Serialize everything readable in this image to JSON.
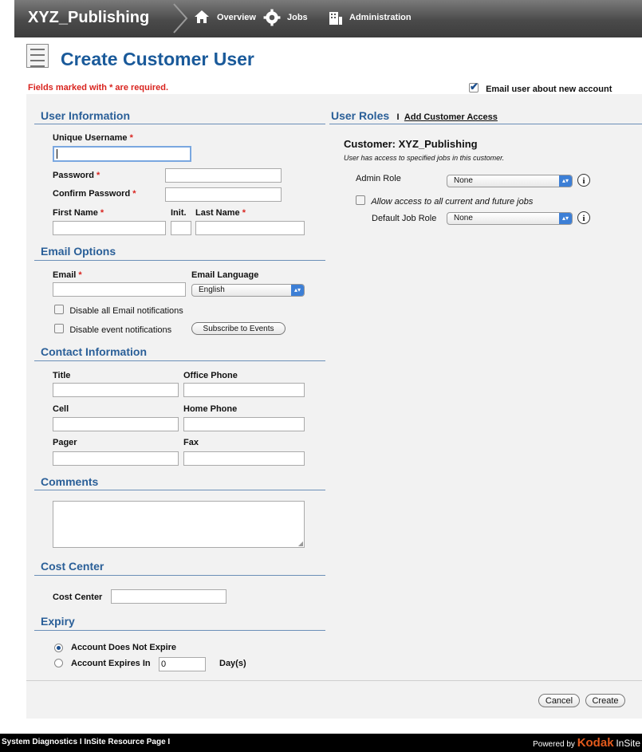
{
  "nav": {
    "brand": "XYZ_Publishing",
    "overview": "Overview",
    "jobs": "Jobs",
    "administration": "Administration"
  },
  "header": {
    "title": "Create Customer User",
    "required_note": "Fields marked with * are required.",
    "email_user_label": "Email user about new account",
    "email_user_checked": true
  },
  "user_info": {
    "section": "User Information",
    "unique_username": "Unique Username",
    "password": "Password",
    "confirm_password": "Confirm Password",
    "first_name": "First Name",
    "init": "Init.",
    "last_name": "Last Name",
    "required_mark": "*"
  },
  "email_options": {
    "section": "Email Options",
    "email": "Email",
    "email_language": "Email Language",
    "language_value": "English",
    "disable_all": "Disable all Email notifications",
    "disable_event": "Disable event notifications",
    "subscribe_button": "Subscribe to Events"
  },
  "contact": {
    "section": "Contact Information",
    "title": "Title",
    "office_phone": "Office Phone",
    "cell": "Cell",
    "home_phone": "Home Phone",
    "pager": "Pager",
    "fax": "Fax"
  },
  "comments": {
    "section": "Comments"
  },
  "cost_center": {
    "section": "Cost Center",
    "label": "Cost Center"
  },
  "expiry": {
    "section": "Expiry",
    "does_not_expire": "Account Does Not Expire",
    "expires_in": "Account Expires In",
    "days_value": "0",
    "days_unit": "Day(s)"
  },
  "roles": {
    "section": "User Roles",
    "separator": "I",
    "add_access": "Add Customer Access",
    "customer_title": "Customer: XYZ_Publishing",
    "customer_desc": "User has access to specified jobs in this customer.",
    "admin_role_label": "Admin Role",
    "admin_role_value": "None",
    "allow_all_jobs": "Allow access to all current and future jobs",
    "default_job_role_label": "Default Job Role",
    "default_job_role_value": "None",
    "info_glyph": "i"
  },
  "actions": {
    "cancel": "Cancel",
    "create": "Create"
  },
  "footer": {
    "links": "System Diagnostics  I  InSite Resource Page  I",
    "powered_by": "Powered by",
    "kodak": "Kodak",
    "insite": "InSite"
  },
  "colors": {
    "accent": "#2a5f98",
    "required": "#d9241f",
    "kodak": "#e35a1c"
  }
}
